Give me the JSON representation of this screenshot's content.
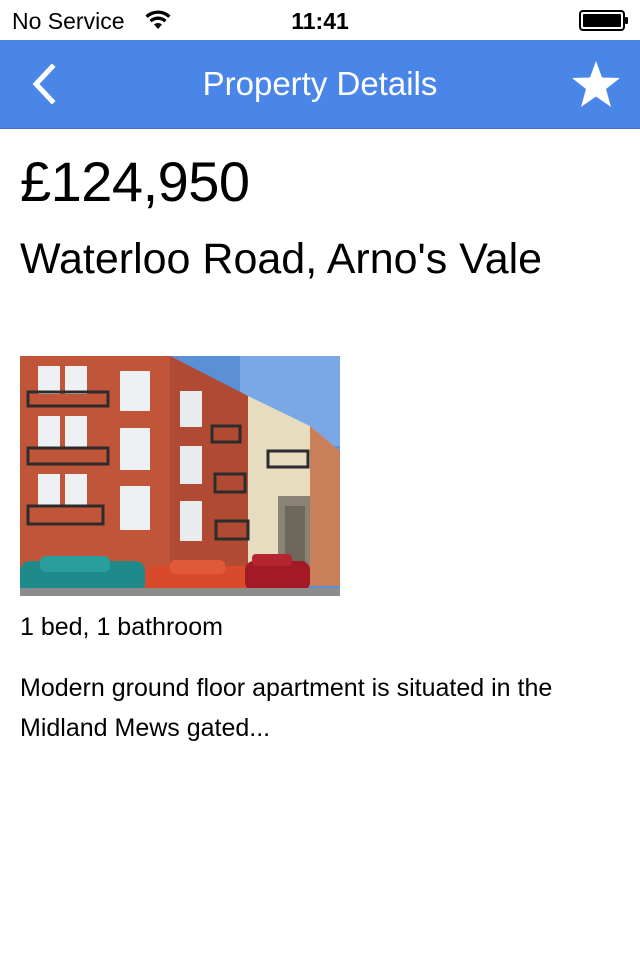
{
  "status_bar": {
    "carrier": "No Service",
    "time": "11:41"
  },
  "nav_bar": {
    "title": "Property Details",
    "background_color": "#4a86e8",
    "back_icon": "chevron-left-icon",
    "favorite_icon": "star-icon"
  },
  "property": {
    "price": "£124,950",
    "address": "Waterloo Road, Arno's Vale",
    "rooms": "1 bed, 1 bathroom",
    "description": "Modern ground floor apartment is situated in the Midland Mews gated..."
  }
}
